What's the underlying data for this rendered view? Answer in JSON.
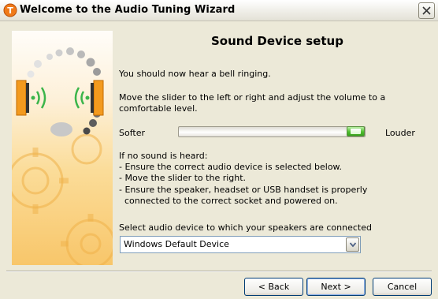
{
  "window": {
    "title": "Welcome to the Audio Tuning Wizard",
    "accent_color": "#f5a623"
  },
  "page": {
    "heading": "Sound Device setup",
    "instruction_1": "You should now hear a bell ringing.",
    "instruction_2_line1": "Move the slider to the left or right and adjust the volume to a",
    "instruction_2_line2": "comfortable level.",
    "slider": {
      "left_label": "Softer",
      "right_label": "Louder",
      "value_percent": 95
    },
    "troubleshoot": {
      "title": "If no sound is heard:",
      "items": [
        "- Ensure the correct audio device is selected below.",
        "- Move the slider to the right.",
        "- Ensure the speaker, headset or USB handset is properly",
        "  connected to the correct socket and powered on."
      ]
    },
    "device_select": {
      "label": "Select audio device to which your speakers are connected",
      "value": "Windows Default Device"
    }
  },
  "buttons": {
    "back": "< Back",
    "next": "Next >",
    "cancel": "Cancel"
  }
}
